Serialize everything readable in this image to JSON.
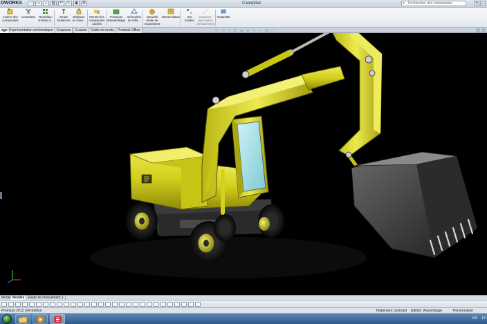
{
  "titlebar": {
    "brand": "DWORKS",
    "title": "Caterpillar",
    "search_placeholder": "Rechercher des commandes"
  },
  "ribbon": {
    "buttons": [
      {
        "label": "Insérer des\ncomposants",
        "icon": "insert-components-icon"
      },
      {
        "label": "Contrainte",
        "icon": "mate-icon"
      },
      {
        "label": "Répétition\nlinéaire d...",
        "icon": "linear-pattern-icon"
      },
      {
        "label": "Smart\nFasteners",
        "icon": "smart-fasteners-icon"
      },
      {
        "label": "Déplacer\nle comp...",
        "icon": "move-component-icon"
      },
      {
        "label": "Montrer les\ncomposants\ncachés",
        "icon": "show-hidden-icon"
      },
      {
        "label": "Fonctions\nd'assemblage",
        "icon": "assembly-features-icon"
      },
      {
        "label": "Géométrie\nde référ...",
        "icon": "reference-geometry-icon"
      },
      {
        "label": "Nouvelle\nétude de\nmouvement",
        "icon": "new-motion-study-icon"
      },
      {
        "label": "Nomenclature",
        "icon": "bom-icon"
      },
      {
        "label": "Vue\néclatée",
        "icon": "exploded-view-icon"
      },
      {
        "label": "Esquisse\navec lignes\nd'éclatement",
        "icon": "explode-line-sketch-icon"
      },
      {
        "label": "Instant3D",
        "icon": "instant3d-icon"
      }
    ]
  },
  "tabs": [
    "age",
    "Représentation schématique",
    "Esquisse",
    "Evaluer",
    "Outils de rendu",
    "Produits Office"
  ],
  "bottom_tabs": [
    "ModelN",
    "Modèle",
    "Étude de mouvement 1"
  ],
  "status": {
    "edition": "Premium 2012 x64 Edition",
    "constraint": "Totalement contraint",
    "mode": "Edition: Assemblage",
    "custom": "Personnalisé"
  },
  "taskbar": {
    "lang": "EN",
    "clock": "12:"
  },
  "colors": {
    "viewport_bg": "#000000",
    "excavator_yellow": "#d7d21b",
    "bucket_gray": "#4a4a4a",
    "glass_cyan": "#a8e0e8"
  }
}
